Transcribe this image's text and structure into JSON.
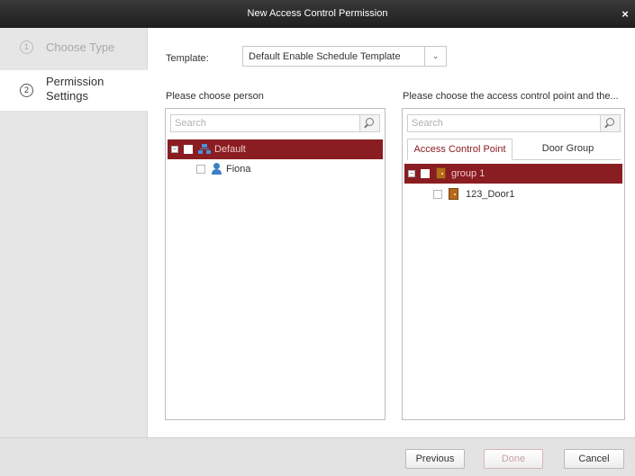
{
  "window": {
    "title": "New Access Control Permission",
    "close_glyph": "×"
  },
  "sidebar": {
    "steps": [
      {
        "number": "1",
        "label": "Choose Type"
      },
      {
        "number": "2",
        "label_line1": "Permission",
        "label_line2": "Settings"
      }
    ]
  },
  "template": {
    "label": "Template:",
    "value": "Default Enable Schedule Template",
    "arrow": "⌄"
  },
  "person_panel": {
    "heading": "Please choose person",
    "search_placeholder": "Search",
    "tree": [
      {
        "label": "Default",
        "icon": "org-icon",
        "expander": "−"
      },
      {
        "label": "Fiona",
        "icon": "person-icon"
      }
    ]
  },
  "access_panel": {
    "heading": "Please choose the access control point and the...",
    "search_placeholder": "Search",
    "tabs": [
      "Access Control Point",
      "Door Group"
    ],
    "tree": [
      {
        "label": "group 1",
        "icon": "door-icon",
        "expander": "−"
      },
      {
        "label": "123_Door1",
        "icon": "door-icon"
      }
    ]
  },
  "footer": {
    "previous": "Previous",
    "done": "Done",
    "cancel": "Cancel"
  },
  "colors": {
    "accent": "#8a1d22",
    "titlebar": "#2b2b2b",
    "sidebar": "#e6e6e6"
  }
}
